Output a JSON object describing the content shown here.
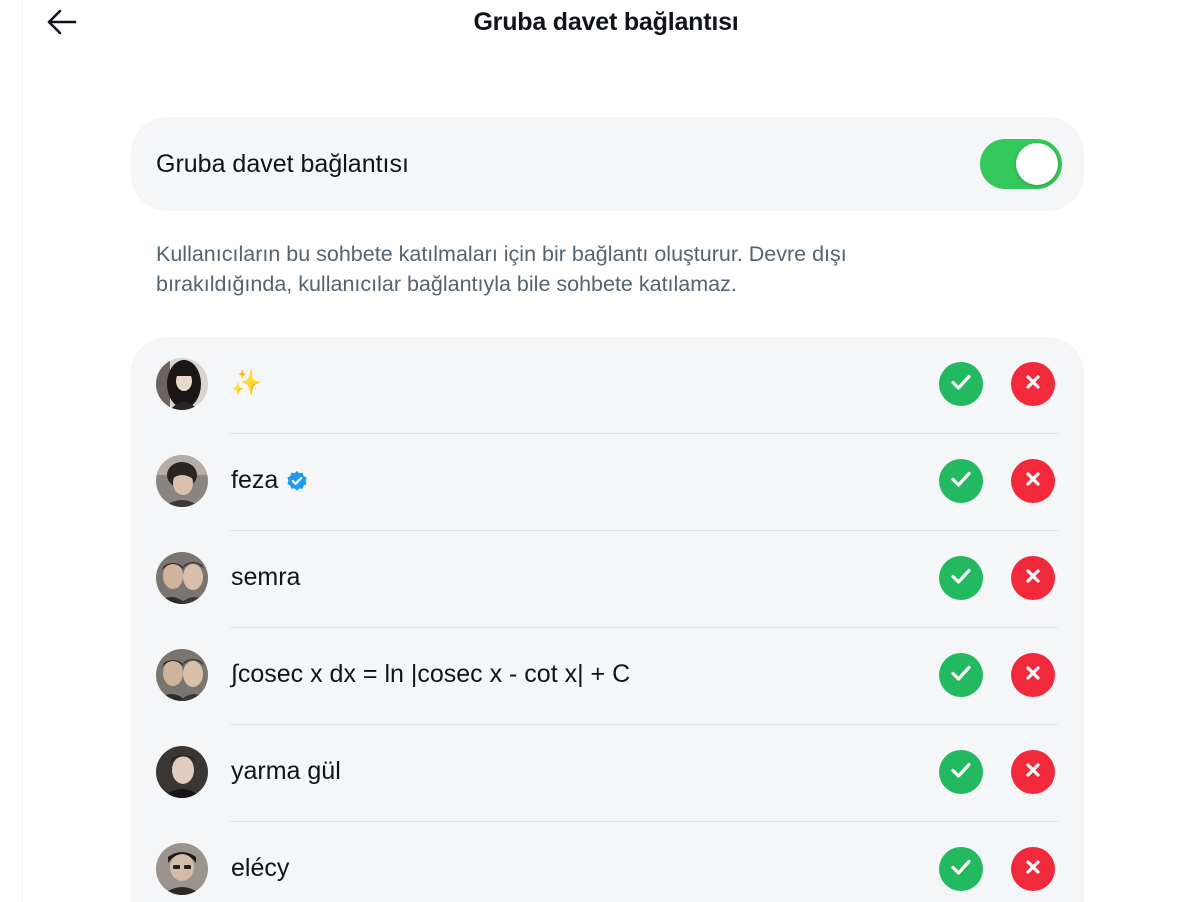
{
  "header": {
    "title": "Gruba davet bağlantısı",
    "back_icon": "arrow-left-icon"
  },
  "invite_toggle": {
    "label": "Gruba davet bağlantısı",
    "enabled": true,
    "on_color": "#34c759"
  },
  "description": "Kullanıcıların bu sohbete katılmaları için bir bağlantı oluşturur. Devre dışı bırakıldığında, kullanıcılar bağlantıyla bile sohbete katılamaz.",
  "requests": [
    {
      "name": "✨",
      "verified": false
    },
    {
      "name": "feza",
      "verified": true
    },
    {
      "name": "semra",
      "verified": false
    },
    {
      "name": "∫cosec x dx = ln |cosec x - cot x| + C",
      "verified": false
    },
    {
      "name": "yarma gül",
      "verified": false
    },
    {
      "name": "elécy",
      "verified": false
    }
  ],
  "colors": {
    "accept": "#22b961",
    "reject": "#f1293b",
    "verified_badge": "#1d9bf0"
  },
  "icons": {
    "accept": "check-icon",
    "reject": "x-icon",
    "verified": "verified-badge-icon"
  }
}
